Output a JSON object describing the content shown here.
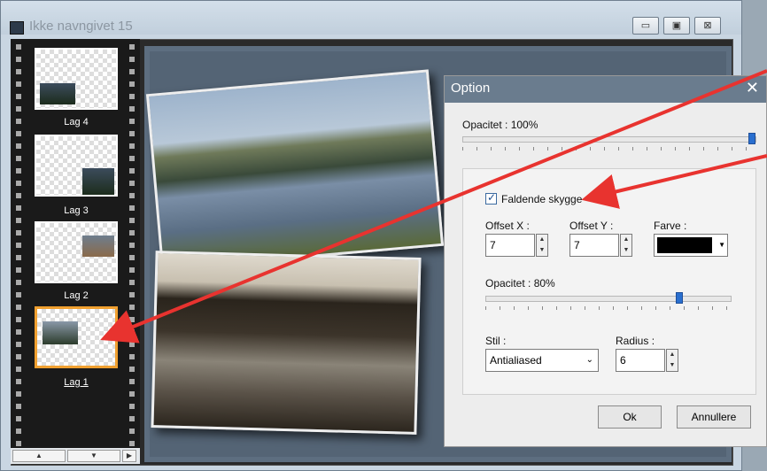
{
  "window": {
    "title": "Ikke navngivet 15"
  },
  "layers": [
    {
      "label": "Lag 4",
      "selected": false
    },
    {
      "label": "Lag 3",
      "selected": false
    },
    {
      "label": "Lag 2",
      "selected": false
    },
    {
      "label": "Lag 1",
      "selected": true
    }
  ],
  "dialog": {
    "title": "Option",
    "opacity_label": "Opacitet : 100%",
    "opacity_value": 100,
    "shadow": {
      "checkbox_label": "Faldende skygge",
      "checked": true,
      "offset_x_label": "Offset X :",
      "offset_x_value": "7",
      "offset_y_label": "Offset Y :",
      "offset_y_value": "7",
      "color_label": "Farve :",
      "color_value": "#000000",
      "opacity_label": "Opacitet : 80%",
      "opacity_value": 80,
      "style_label": "Stil :",
      "style_value": "Antialiased",
      "radius_label": "Radius :",
      "radius_value": "6"
    },
    "ok_label": "Ok",
    "cancel_label": "Annullere"
  },
  "annotation_color": "#e8332f"
}
